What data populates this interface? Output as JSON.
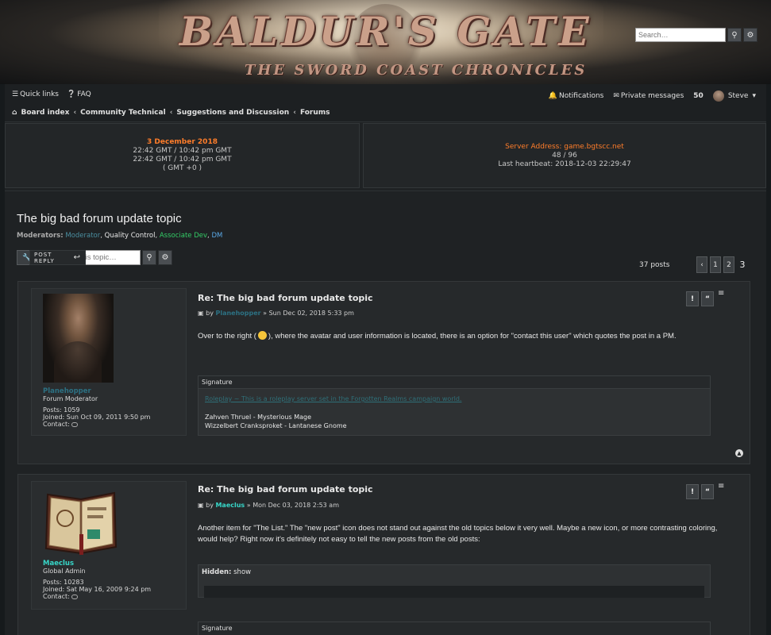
{
  "banner": {
    "logo_line1": "BALDUR'S GATE",
    "logo_line2": "THE SWORD COAST CHRONICLES",
    "search_placeholder": "Search…"
  },
  "nav": {
    "quick_links": "Quick links",
    "faq": "FAQ",
    "notifications": "Notifications",
    "private_messages": "Private messages",
    "pm_count": "50",
    "user": "Steve",
    "breadcrumbs": [
      "Board index",
      "Community Technical",
      "Suggestions and Discussion",
      "Forums"
    ]
  },
  "time_panel": {
    "date": "3 December 2018",
    "line1": "22:42 GMT / 10:42 pm GMT",
    "line2": "22:42 GMT / 10:42 pm GMT",
    "line3": "( GMT +0 )"
  },
  "server_panel": {
    "address": "Server Address: game.bgtscc.net",
    "players": "48 / 96",
    "heartbeat": "Last heartbeat: 2018-12-03 22:29:47"
  },
  "topic": {
    "title": "The big bad forum update topic",
    "moderators_label": "Moderators:",
    "moderators": [
      "Moderator",
      "Quality Control",
      "Associate Dev",
      "DM"
    ],
    "post_reply": "POST REPLY",
    "search_placeholder": "Search this topic…",
    "posts_count": "37 posts",
    "pages": [
      "1",
      "2",
      "3"
    ]
  },
  "posts": [
    {
      "title": "Re: The big bad forum update topic",
      "by": "by",
      "author": "Planehopper",
      "date": "» Sun Dec 02, 2018 5:33 pm",
      "body_a": "Over to the right (",
      "body_b": "), where the avatar and user information is located, there is an option for \"contact this user\" which quotes the post in a PM.",
      "user": {
        "name": "Planehopper",
        "rank": "Forum Moderator",
        "posts": "Posts: 1059",
        "joined": "Joined: Sun Oct 09, 2011 9:50 pm",
        "contact": "Contact:"
      },
      "signature": {
        "label": "Signature",
        "link": "Roleplay ~ This is a roleplay server set in the Forgotten Realms campaign world.",
        "line1": "Zahven Thruel - Mysterious Mage",
        "line2": "Wizzelbert Cranksproket - Lantanese Gnome"
      }
    },
    {
      "title": "Re: The big bad forum update topic",
      "by": "by",
      "author": "Maeclus",
      "date": "» Mon Dec 03, 2018 2:53 am",
      "body": "Another item for \"The List.\" The \"new post\" icon does not stand out against the old topics below it very well. Maybe a new icon, or more contrasting coloring, would help? Right now it's definitely not easy to tell the new posts from the old posts:",
      "hidden_label": "Hidden:",
      "hidden_action": "show",
      "user": {
        "name": "Maeclus",
        "rank": "Global Admin",
        "posts": "Posts: 10283",
        "joined": "Joined: Sat May 16, 2009 9:24 pm",
        "contact": "Contact:"
      },
      "signature_label": "Signature"
    }
  ],
  "colors": {
    "server_text": "#ff7d2a",
    "user1": "#2c7183",
    "user2": "#37d6c8",
    "mod_associate": "#33cc66",
    "mod_dm": "#5aa8e6"
  }
}
